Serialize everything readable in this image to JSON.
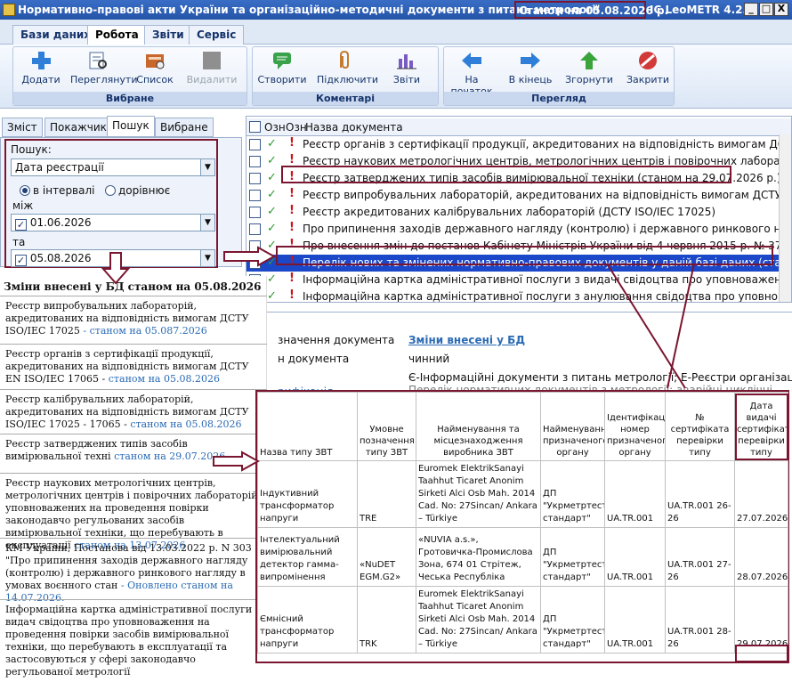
{
  "window": {
    "title": "Нормативно-правові акти України та організаційно-методичні документи з питань метрології",
    "stamp": "Станом на 05.08.2026 р.",
    "app_name": "ІС LeoMETR 4.2.7",
    "buttons": [
      "_",
      "□",
      "X"
    ]
  },
  "ribbon": {
    "tabs": [
      "Бази даних",
      "Робота",
      "Звіти",
      "Сервіс"
    ],
    "active_tab": "Робота",
    "groups": [
      {
        "title": "Вибране",
        "buttons": [
          {
            "label": "Додати",
            "icon": "plus-icon"
          },
          {
            "label": "Переглянути",
            "icon": "view-icon"
          },
          {
            "label": "Список",
            "icon": "list-icon"
          },
          {
            "label": "Видалити",
            "icon": "delete-icon",
            "disabled": true
          }
        ]
      },
      {
        "title": "Коментарі",
        "buttons": [
          {
            "label": "Створити",
            "icon": "comment-icon"
          },
          {
            "label": "Підключити",
            "icon": "paperclip-icon"
          },
          {
            "label": "Звіти",
            "icon": "chart-icon"
          }
        ]
      },
      {
        "title": "Перегляд",
        "buttons": [
          {
            "label": "На початок",
            "icon": "arrow-left-icon"
          },
          {
            "label": "В кінець",
            "icon": "arrow-right-icon"
          },
          {
            "label": "Згорнути",
            "icon": "arrow-up-icon"
          },
          {
            "label": "Закрити",
            "icon": "close-circle-icon"
          }
        ]
      }
    ]
  },
  "left_tabs": [
    "Зміст",
    "Покажчик",
    "Пошук",
    "Вибране"
  ],
  "active_left_tab": "Пошук",
  "search": {
    "label": "Пошук:",
    "field": "Дата реєстрації",
    "radio_interval": "в інтервалі",
    "radio_equal": "дорівнює",
    "between_label": "між",
    "date_from": "01.06.2026",
    "and_label": "та",
    "date_to": "05.08.2026"
  },
  "doc_list": {
    "headers": [
      "Озн",
      "Озн",
      "Назва документа"
    ],
    "rows": [
      "Реєстр органів з сертифікації продукції, акредитованих на відповідність вимогам ДСТУ EN ISO/",
      "Реєстр наукових метрологічних центрів, метрологічних центрів і повірочних лабораторій, упо",
      "Реєстр затверджених типів засобів вимірювальної техніки  (станом на 29.07.2026 р.)",
      "Реєстр випробувальних лабораторій, акредитованих на відповідність вимогам ДСТУ EN ISO/",
      "Реєстр акредитованих калібрувальних лабораторій (ДСТУ ISO/IEC 17025)",
      "Про припинення заходів державного нагляду (контролю) і державного ринкового нагляду у",
      "Про внесення змін до постанов Кабінету Міністрів України від 4 червня 2015 р. № 374 і від 1",
      "Перелік нових та змінених нормативно-правових документів у даній базі даних (станом на 0",
      "Інформаційна картка адміністративної послуги з видачі свідоцтва про уповноваження на про",
      "Інформаційна картка адміністративної послуги з анулювання свідоцтва про уповноваження"
    ],
    "selected_index": 7
  },
  "detail": {
    "label_name": "значення документа",
    "value_name": "Зміни внесені у БД",
    "label_status": "н документа",
    "value_status": "чинний",
    "label_cat": "рифікація",
    "value_cat": "Є-Інформаційні документи з питань метрології; Е-Реєстри організацій та",
    "value_cat2": "Перелік нормативних документів з метрології; аварійні циклічні"
  },
  "changes": {
    "title": "Зміни внесені у БД станом на 05.08.2026",
    "entries": [
      {
        "text": "Реєстр випробувальних лабораторій, акредитованих на відповідність вимогам ДСТУ ISO/IEC 17025",
        "link": "- станом на 05.087.2026"
      },
      {
        "text": "Реєстр органів з сертифікації продукції, акредитованих на відповідність вимогам ДСТУ EN ISO/IEC 17065 -",
        "link": "станом на 05.08.2026"
      },
      {
        "text": "Реєстр калібрувальних лабораторій, акредитованих на відповідність вимогам ДСТУ ISO/IEC 17025 - 17065 -",
        "link": "станом на 05.08.2026"
      },
      {
        "text": "Реєстр затверджених типів засобів вимірювальної техні",
        "link": "станом на 29.07.2026"
      },
      {
        "text": "Реєстр наукових метрологічних центрів, метрологічних центрів і повірочних лабораторій, уповноважених на проведення повірки законодавчо регульованих засобів вимірювальної техніки, що перебувають в експлуатації",
        "link": "станом на 13.07.2026"
      },
      {
        "text": "КМ України, Постанова від 13.03.2022 р. N 303 \"Про припинення заходів державного нагляду (контролю) і державного ринкового нагляду в умовах воєнного стан",
        "link": "- Оновлено станом на 14.07.2026."
      },
      {
        "text": "Інформаційна картка адміністративної послуги з видач свідоцтва про уповноваження на проведення повірки засобів вимірювальної техніки, що перебувають в експлуатації та застосовуються у сфері законодавчо регульованої метрології",
        "link": ""
      }
    ]
  },
  "cert_table": {
    "headers": [
      "Назва типу ЗВТ",
      "Умовне позначення типу ЗВТ",
      "Найменування та місцезнаходження виробника ЗВТ",
      "Найменування призначеного органу",
      "Ідентифікаційний номер призначеного органу",
      "№ сертифіката перевірки типу",
      "Дата видачі сертифіката перевірки типу"
    ],
    "rows": [
      [
        "Індуктивний трансформатор напруги",
        "TRE",
        "Euromek ElektrikSanayi Taahhut Ticaret Anonim Sirketi Alci Osb Mah. 2014 Cad. No: 27Sincan/ Ankara – Türkiye",
        "ДП \"Укрметртест стандарт\"",
        "UA.TR.001",
        "UA.TR.001 26-26",
        "27.07.2026"
      ],
      [
        "Інтелектуальний вимірювальний детектор гамма-випромінення",
        "«NuDET EGM.G2»",
        "«NUVIA a.s.», Гротовичка-Промислова Зона, 674 01 Стрітеж, Чеська Республіка",
        "ДП \"Укрметртест стандарт\"",
        "UA.TR.001",
        "UA.TR.001 27-26",
        "28.07.2026"
      ],
      [
        "Ємнісний трансформатор напруги",
        "TRK",
        "Euromek ElektrikSanayi Taahhut Ticaret Anonim Sirketi Alci Osb Mah. 2014 Cad. No: 27Sincan/ Ankara – Türkiye",
        "ДП \"Укрметртест стандарт\"",
        "UA.TR.001",
        "UA.TR.001 28-26",
        "29.07.2026"
      ]
    ]
  },
  "colors": {
    "highlight": "#7a1630",
    "selection": "#1a48c8",
    "link": "#2b6bb5",
    "ribbon_text": "#15336b"
  }
}
